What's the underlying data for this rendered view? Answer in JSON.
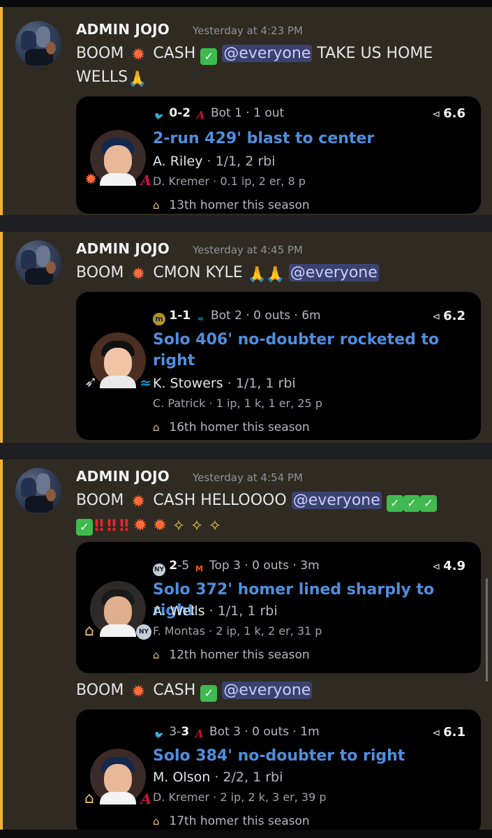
{
  "messages": [
    {
      "username": "ADMIN JOJO",
      "timestamp": "Yesterday at 4:23 PM",
      "line1": {
        "a": "BOOM",
        "b": "CASH",
        "mention": "@everyone",
        "c": "TAKE US HOME"
      },
      "line2": {
        "a": "WELLS"
      },
      "card": {
        "away_score": "0-2",
        "inning": "Bot 1 · 1 out",
        "exit_velo": "6.6",
        "title": "2-run 429' blast to center",
        "batter": "A. Riley",
        "batter_stats": "· 1/1, 2 rbi",
        "pitcher": "D. Kremer · 0.1 ip, 2 er, 8 p",
        "homer_note": "13th homer this season",
        "away_icon": "orioles-logo-icon",
        "home_icon": "braves-logo-icon"
      }
    },
    {
      "username": "ADMIN JOJO",
      "timestamp": "Yesterday at 4:45 PM",
      "line1": {
        "a": "BOOM",
        "b": "CMON KYLE",
        "mention": "@everyone"
      },
      "card": {
        "away_score": "1-1",
        "inning": "Bot 2 · 0 outs · 6m",
        "exit_velo": "6.2",
        "title": "Solo 406' no-doubter rocketed to right",
        "batter": "K. Stowers",
        "batter_stats": "· 1/1, 1 rbi",
        "pitcher": "C. Patrick · 1 ip, 1 k, 1 er, 25 p",
        "homer_note": "16th homer this season",
        "away_icon": "brewers-logo-icon",
        "home_icon": "marlins-logo-icon"
      }
    },
    {
      "username": "ADMIN JOJO",
      "timestamp": "Yesterday at 4:54 PM",
      "line1": {
        "a": "BOOM",
        "b": "CASH HELLOOOO",
        "mention": "@everyone"
      },
      "card": {
        "away_score_a": "2",
        "away_score_b": "-5",
        "inning": "Top 3 · 0 outs · 3m",
        "exit_velo": "4.9",
        "title": "Solo 372' homer lined sharply to right",
        "batter": "A. Wells",
        "batter_stats": "· 1/1, 1 rbi",
        "pitcher": "F. Montas · 2 ip, 1 k, 2 er, 31 p",
        "homer_note": "12th homer this season",
        "away_icon": "yankees-logo-icon",
        "home_icon": "mets-logo-icon"
      },
      "followup": {
        "a": "BOOM",
        "b": "CASH",
        "mention": "@everyone"
      },
      "card2": {
        "away_score_a": "3-",
        "away_score_b": "3",
        "inning": "Bot 3 · 0 outs · 1m",
        "exit_velo": "6.1",
        "title": "Solo 384' no-doubter to right",
        "batter": "M. Olson",
        "batter_stats": "· 2/2, 1 rbi",
        "pitcher": "D. Kremer · 2 ip, 2 k, 3 er, 39 p",
        "homer_note": "17th homer this season",
        "away_icon": "orioles-logo-icon",
        "home_icon": "braves-logo-icon"
      }
    }
  ]
}
